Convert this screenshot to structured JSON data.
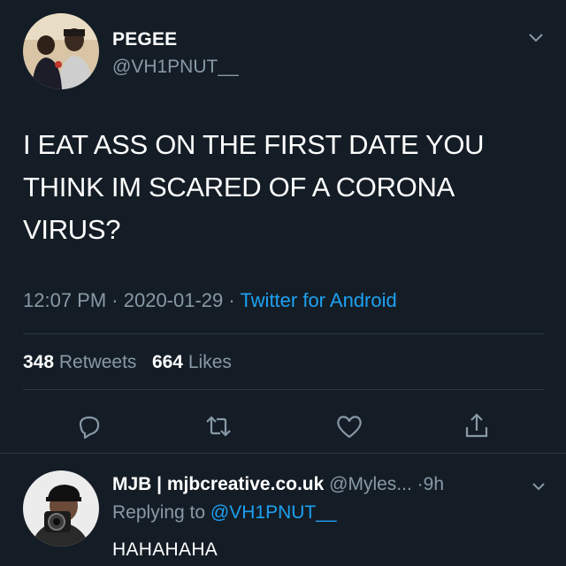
{
  "tweet": {
    "display_name": "PEGEE",
    "handle": "@VH1PNUT__",
    "text": "I EAT ASS ON THE FIRST DATE YOU THINK IM SCARED OF A CORONA VIRUS?",
    "time": "12:07 PM",
    "date": "2020-01-29",
    "source": "Twitter for Android",
    "retweets_count": "348",
    "retweets_label": "Retweets",
    "likes_count": "664",
    "likes_label": "Likes",
    "icons": {
      "avatar": "profile-photo",
      "menu": "chevron-down-icon",
      "reply": "comment-icon",
      "retweet": "retweet-icon",
      "like": "heart-icon",
      "share": "share-icon"
    }
  },
  "reply": {
    "display_name": "MJB | mjbcreative.co.uk",
    "handle": "@Myles...",
    "time": "9h",
    "replying_prefix": "Replying to",
    "replying_to": "@VH1PNUT__",
    "text": "HAHAHAHA"
  },
  "colors": {
    "background": "#141d26",
    "primary_text": "#ffffff",
    "secondary_text": "#8899a6",
    "accent": "#1da1f2",
    "divider": "#2b3640"
  }
}
